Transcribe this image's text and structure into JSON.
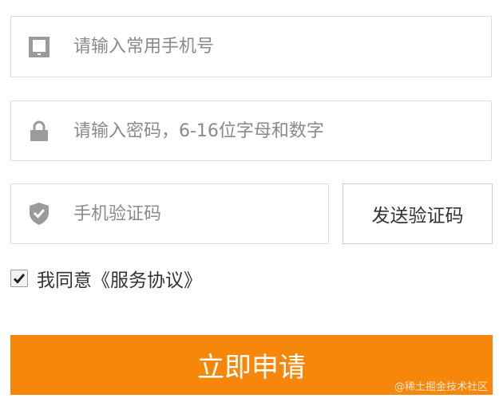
{
  "form": {
    "phone": {
      "placeholder": "请输入常用手机号",
      "value": "",
      "icon": "phone-icon"
    },
    "password": {
      "placeholder": "请输入密码，6-16位字母和数字",
      "value": "",
      "icon": "lock-icon"
    },
    "sms_code": {
      "placeholder": "手机验证码",
      "value": "",
      "icon": "shield-icon"
    },
    "send_code_label": "发送验证码",
    "agree": {
      "checked": true,
      "label": "我同意《服务协议》"
    },
    "submit_label": "立即申请"
  },
  "watermark": "@稀土掘金技术社区",
  "colors": {
    "accent": "#f7870b",
    "icon": "#9b9b9b",
    "border": "#dcdcdc"
  }
}
